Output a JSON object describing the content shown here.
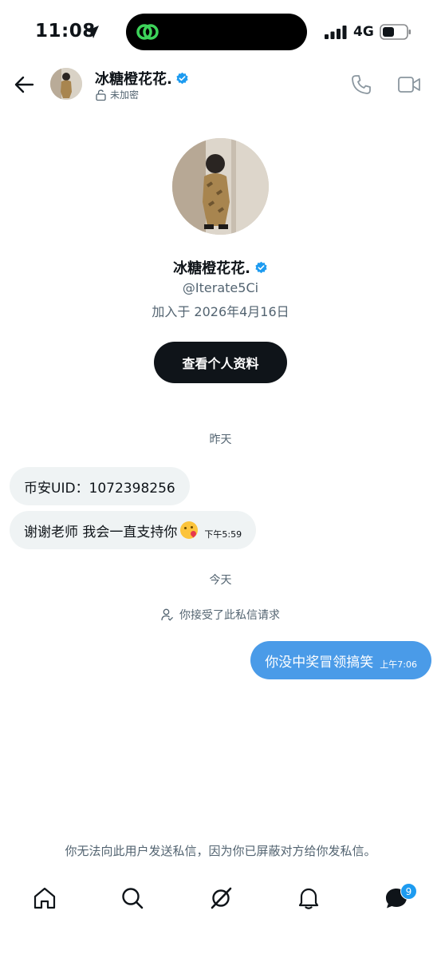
{
  "status_bar": {
    "time": "11:08",
    "network": "4G"
  },
  "header": {
    "name": "冰糖橙花花.",
    "encryption": "未加密"
  },
  "profile": {
    "name": "冰糖橙花花.",
    "handle": "@Iterate5Ci",
    "joined": "加入于 2026年4月16日",
    "view_profile_label": "查看个人资料"
  },
  "messages": {
    "day1": "昨天",
    "msg1": {
      "text": "币安UID：1072398256"
    },
    "msg2": {
      "text": "谢谢老师 我会一直支持你",
      "emoji": "kissing-face-emoji",
      "time": "下午5:59"
    },
    "day2": "今天",
    "accepted_note": "你接受了此私信请求",
    "msg3": {
      "text": "你没中奖冒领搞笑",
      "time": "上午7:06"
    }
  },
  "blocked_note": "你无法向此用户发送私信，因为你已屏蔽对方给你发私信。",
  "tab_bar": {
    "icons": [
      "home-icon",
      "search-icon",
      "grok-icon",
      "bell-icon",
      "messages-icon"
    ],
    "messages_badge": "9"
  },
  "colors": {
    "accent": "#1d9bf0",
    "outgoing_bubble": "#4a9be8",
    "incoming_bubble": "#eff3f4",
    "text_secondary": "#536471"
  }
}
